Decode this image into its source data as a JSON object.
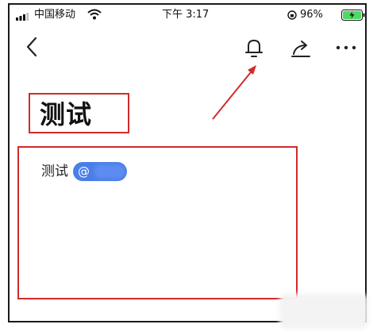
{
  "status_bar": {
    "carrier": "中国移动",
    "time": "下午 3:17",
    "battery": "96%"
  },
  "nav": {
    "back_icon": "chevron-left-icon",
    "bell_icon": "bell-icon",
    "share_icon": "share-icon",
    "more_icon": "more-icon"
  },
  "document": {
    "title": "测试",
    "body_text": "测试",
    "mention": "@"
  },
  "colors": {
    "annotation": "#d12b2b",
    "mention_chip": "#4a7ee8"
  }
}
